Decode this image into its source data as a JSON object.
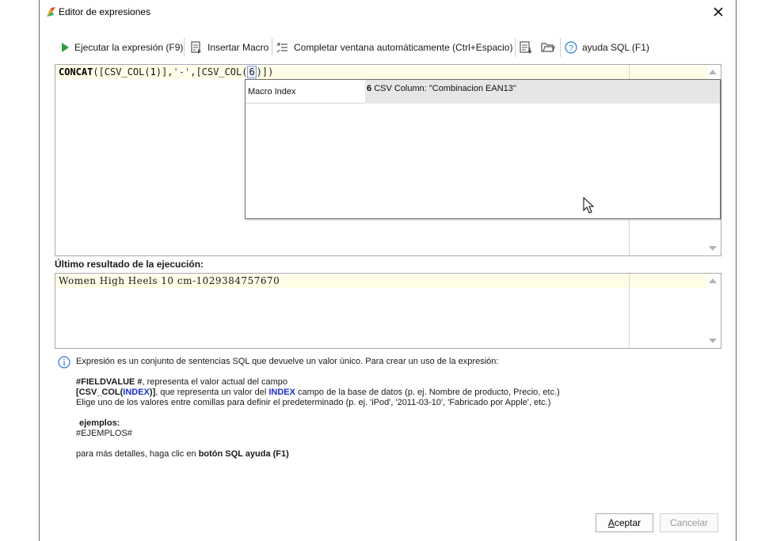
{
  "window": {
    "title": "Editor de expresiones"
  },
  "toolbar": {
    "run_label": "Ejecutar la expresión (F9)",
    "insert_macro_label": "Insertar Macro",
    "autocomplete_label": "Completar ventana automáticamente (Ctrl+Espacio)",
    "help_label": "ayuda SQL (F1)"
  },
  "editor": {
    "tokens": {
      "fn": "CONCAT",
      "open": "([CSV_COL(",
      "n1": "1",
      "mid1": ")],",
      "sep": "'-'",
      "mid2": ",[CSV_COL(",
      "n2": "6",
      "close": ")])"
    }
  },
  "popup": {
    "label": "Macro Index",
    "value_index": "6",
    "value_text": "CSV Column: \"Combinacion EAN13\""
  },
  "result": {
    "label": "Último resultado de la ejecución:",
    "value": "Women High Heels 10 cm-1029384757670"
  },
  "help": {
    "intro": "Expresión es un conjunto de sentencias SQL que devuelve un valor único. Para crear un uso de la expresión:",
    "fieldvalue_token": "#FIELDVALUE #",
    "fieldvalue_text": ", representa el valor actual del campo",
    "csvcol_open": "[CSV_COL(",
    "csvcol_index": "INDEX",
    "csvcol_close": ")]",
    "csvcol_text1": ", que representa un valor del ",
    "csvcol_index2": "INDEX",
    "csvcol_text2": " campo de la base de datos (p. ej. Nombre de producto, Precio, etc.)",
    "quotes_line": "Elige uno de los valores entre comillas para definir el predeterminado (p. ej. 'iPod', '2011-03-10', 'Fabricado por Apple', etc.)",
    "examples_label": "ejemplos:",
    "examples_value": "#EJEMPLOS#",
    "details_text": "para más detalles, haga clic en ",
    "details_bold": "botón SQL ayuda (F1)"
  },
  "buttons": {
    "ok_accel": "A",
    "ok_rest": "ceptar",
    "cancel": "Cancelar"
  },
  "colors": {
    "accent_blue": "#1a2fd1",
    "run_green": "#2e9e3e",
    "editor_line": "#fffde6"
  }
}
